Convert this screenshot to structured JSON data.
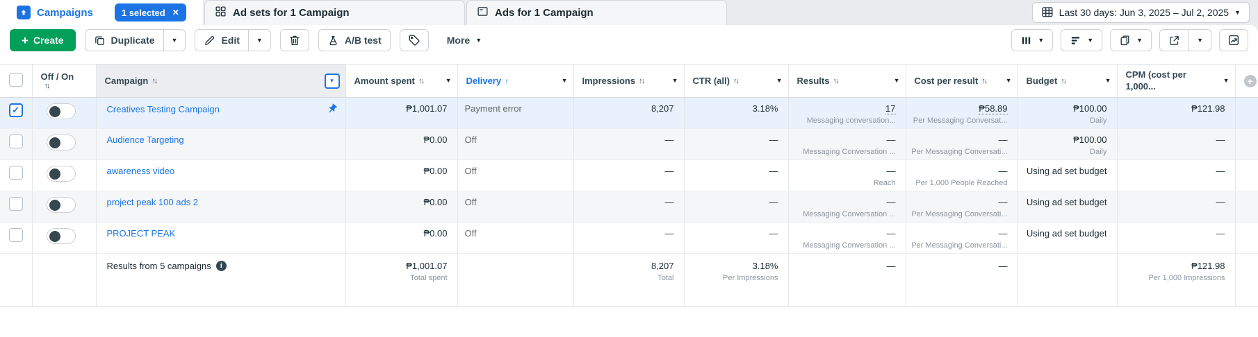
{
  "tab_bar": {
    "campaigns_tab": {
      "label": "Campaigns",
      "selected_badge": "1 selected"
    },
    "adsets_tab": {
      "label": "Ad sets for 1 Campaign"
    },
    "ads_tab": {
      "label": "Ads for 1 Campaign"
    },
    "date_range": "Last 30 days: Jun 3, 2025 – Jul 2, 2025"
  },
  "toolbar": {
    "create_label": "Create",
    "duplicate_label": "Duplicate",
    "edit_label": "Edit",
    "ab_test_label": "A/B test",
    "more_label": "More"
  },
  "table": {
    "headers": {
      "off_on": "Off / On",
      "campaign": "Campaign",
      "amount_spent": "Amount spent",
      "delivery": "Delivery",
      "impressions": "Impressions",
      "ctr": "CTR (all)",
      "results": "Results",
      "cost_per_result": "Cost per result",
      "budget": "Budget",
      "cpm": "CPM (cost per 1,000..."
    },
    "rows": [
      {
        "selected": true,
        "pinned": true,
        "campaign": "Creatives Testing Campaign",
        "amount_spent": "₱1,001.07",
        "delivery": "Payment error",
        "impressions": "8,207",
        "ctr": "3.18%",
        "results": "17",
        "results_sub": "Messaging conversation...",
        "cost_per_result": "₱58.89",
        "cost_per_result_sub": "Per Messaging Conversat...",
        "budget": "₱100.00",
        "budget_sub": "Daily",
        "cpm": "₱121.98"
      },
      {
        "selected": false,
        "pinned": false,
        "campaign": "Audience Targeting",
        "amount_spent": "₱0.00",
        "delivery": "Off",
        "impressions": "—",
        "ctr": "—",
        "results": "—",
        "results_sub": "Messaging Conversation ...",
        "cost_per_result": "—",
        "cost_per_result_sub": "Per Messaging Conversati...",
        "budget": "₱100.00",
        "budget_sub": "Daily",
        "cpm": "—"
      },
      {
        "selected": false,
        "pinned": false,
        "campaign": "awareness video",
        "amount_spent": "₱0.00",
        "delivery": "Off",
        "impressions": "—",
        "ctr": "—",
        "results": "—",
        "results_sub": "Reach",
        "cost_per_result": "—",
        "cost_per_result_sub": "Per 1,000 People Reached",
        "budget": "Using ad set budget",
        "budget_sub": "",
        "cpm": "—"
      },
      {
        "selected": false,
        "pinned": false,
        "campaign": "project peak 100 ads 2",
        "amount_spent": "₱0.00",
        "delivery": "Off",
        "impressions": "—",
        "ctr": "—",
        "results": "—",
        "results_sub": "Messaging Conversation ...",
        "cost_per_result": "—",
        "cost_per_result_sub": "Per Messaging Conversati...",
        "budget": "Using ad set budget",
        "budget_sub": "",
        "cpm": "—"
      },
      {
        "selected": false,
        "pinned": false,
        "campaign": "PROJECT PEAK",
        "amount_spent": "₱0.00",
        "delivery": "Off",
        "impressions": "—",
        "ctr": "—",
        "results": "—",
        "results_sub": "Messaging Conversation ...",
        "cost_per_result": "—",
        "cost_per_result_sub": "Per Messaging Conversati...",
        "budget": "Using ad set budget",
        "budget_sub": "",
        "cpm": "—"
      }
    ],
    "footer": {
      "label": "Results from 5 campaigns",
      "amount_spent": "₱1,001.07",
      "amount_spent_sub": "Total spent",
      "impressions": "8,207",
      "impressions_sub": "Total",
      "ctr": "3.18%",
      "ctr_sub": "Per Impressions",
      "results": "—",
      "cost_per_result": "—",
      "cpm": "₱121.98",
      "cpm_sub": "Per 1,000 Impressions"
    }
  },
  "colors": {
    "accent_blue": "#1b74e4",
    "create_green": "#00a05b",
    "selected_row_blue": "#e9f2fc",
    "header_text": "#344854"
  }
}
